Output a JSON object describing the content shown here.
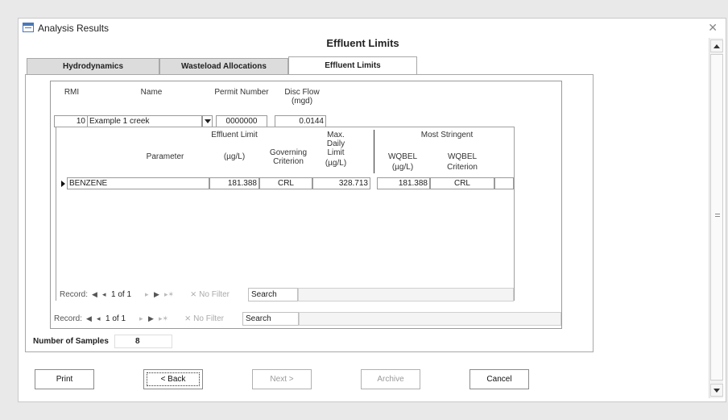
{
  "window": {
    "title": "Analysis Results"
  },
  "form": {
    "header": "Effluent Limits"
  },
  "tabs": [
    {
      "label": "Hydrodynamics",
      "active": false
    },
    {
      "label": "Wasteload Allocations",
      "active": false
    },
    {
      "label": "Effluent Limits",
      "active": true
    }
  ],
  "discharge": {
    "headers": {
      "rmi": "RMI",
      "name": "Name",
      "permit": "Permit Number",
      "flow": "Disc Flow",
      "flow_unit": "(mgd)"
    },
    "row": {
      "rmi": "10",
      "name": "Example 1 creek",
      "permit": "0000000",
      "flow": "0.0144"
    }
  },
  "limits": {
    "headers": {
      "effluent_limit": "Effluent Limit",
      "max": "Max.",
      "daily": "Daily",
      "limit": "Limit",
      "most_stringent": "Most Stringent",
      "parameter": "Parameter",
      "ugl": "(µg/L)",
      "governing": "Governing",
      "criterion": "Criterion",
      "wqbel": "WQBEL"
    },
    "rows": [
      {
        "parameter": "BENZENE",
        "effluent_limit": "181.388",
        "governing_criterion": "CRL",
        "max_daily_limit": "328.713",
        "wqbel": "181.388",
        "wqbel_criterion": "CRL"
      }
    ]
  },
  "inner_nav": {
    "record_label": "Record:",
    "position": "1 of 1",
    "filter": "No Filter",
    "search": "Search"
  },
  "outer_nav": {
    "record_label": "Record:",
    "position": "1 of 1",
    "filter": "No Filter",
    "search": "Search"
  },
  "samples": {
    "label": "Number of Samples",
    "value": "8"
  },
  "buttons": {
    "print": {
      "label": "Print",
      "enabled": true
    },
    "back": {
      "label": "< Back",
      "enabled": true
    },
    "next": {
      "label": "Next >",
      "enabled": false
    },
    "archive": {
      "label": "Archive",
      "enabled": false
    },
    "cancel": {
      "label": "Cancel",
      "enabled": true
    }
  },
  "icons": [
    "form-icon",
    "close-icon",
    "record-selector-icon",
    "first-record-icon",
    "prev-record-icon",
    "next-record-icon",
    "last-record-icon",
    "new-record-icon",
    "filter-icon",
    "scroll-up-icon",
    "scroll-down-icon"
  ],
  "colors": {
    "background": "#e9e9e9",
    "tab_inactive": "#dcdcdc",
    "disabled_text": "#9a9a9a"
  }
}
